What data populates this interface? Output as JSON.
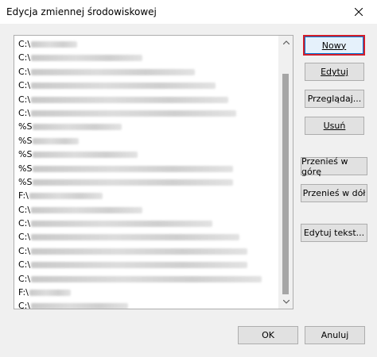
{
  "window": {
    "title": "Edycja zmiennej środowiskowej",
    "close_icon": "close-icon"
  },
  "list": {
    "rows": [
      {
        "prefix": "C:\\",
        "blur_width": 58
      },
      {
        "prefix": "C:\\",
        "blur_width": 140
      },
      {
        "prefix": "C:\\",
        "blur_width": 206
      },
      {
        "prefix": "C:\\",
        "blur_width": 232
      },
      {
        "prefix": "C:\\",
        "blur_width": 248
      },
      {
        "prefix": "C:\\",
        "blur_width": 258
      },
      {
        "prefix": "%S",
        "blur_width": 112
      },
      {
        "prefix": "%S",
        "blur_width": 58
      },
      {
        "prefix": "%S",
        "blur_width": 132
      },
      {
        "prefix": "%S",
        "blur_width": 252
      },
      {
        "prefix": "%S",
        "blur_width": 252
      },
      {
        "prefix": "F:\\",
        "blur_width": 92
      },
      {
        "prefix": "C:\\",
        "blur_width": 140
      },
      {
        "prefix": "C:\\",
        "blur_width": 228
      },
      {
        "prefix": "C:\\",
        "blur_width": 262
      },
      {
        "prefix": "C:\\",
        "blur_width": 272
      },
      {
        "prefix": "C:\\",
        "blur_width": 272
      },
      {
        "prefix": "C:\\",
        "blur_width": 290
      },
      {
        "prefix": "F:\\",
        "blur_width": 52
      },
      {
        "prefix": "C:\\",
        "blur_width": 122
      }
    ]
  },
  "buttons": {
    "new": "Nowy",
    "edit": "Edytuj",
    "browse": "Przeglądaj...",
    "delete": "Usuń",
    "move_up": "Przenieś w górę",
    "move_down": "Przenieś w dół",
    "edit_text": "Edytuj tekst...",
    "ok": "OK",
    "cancel": "Anuluj"
  },
  "colors": {
    "default_button_highlight": "#d21e2b",
    "focus_border": "#0078d7"
  }
}
